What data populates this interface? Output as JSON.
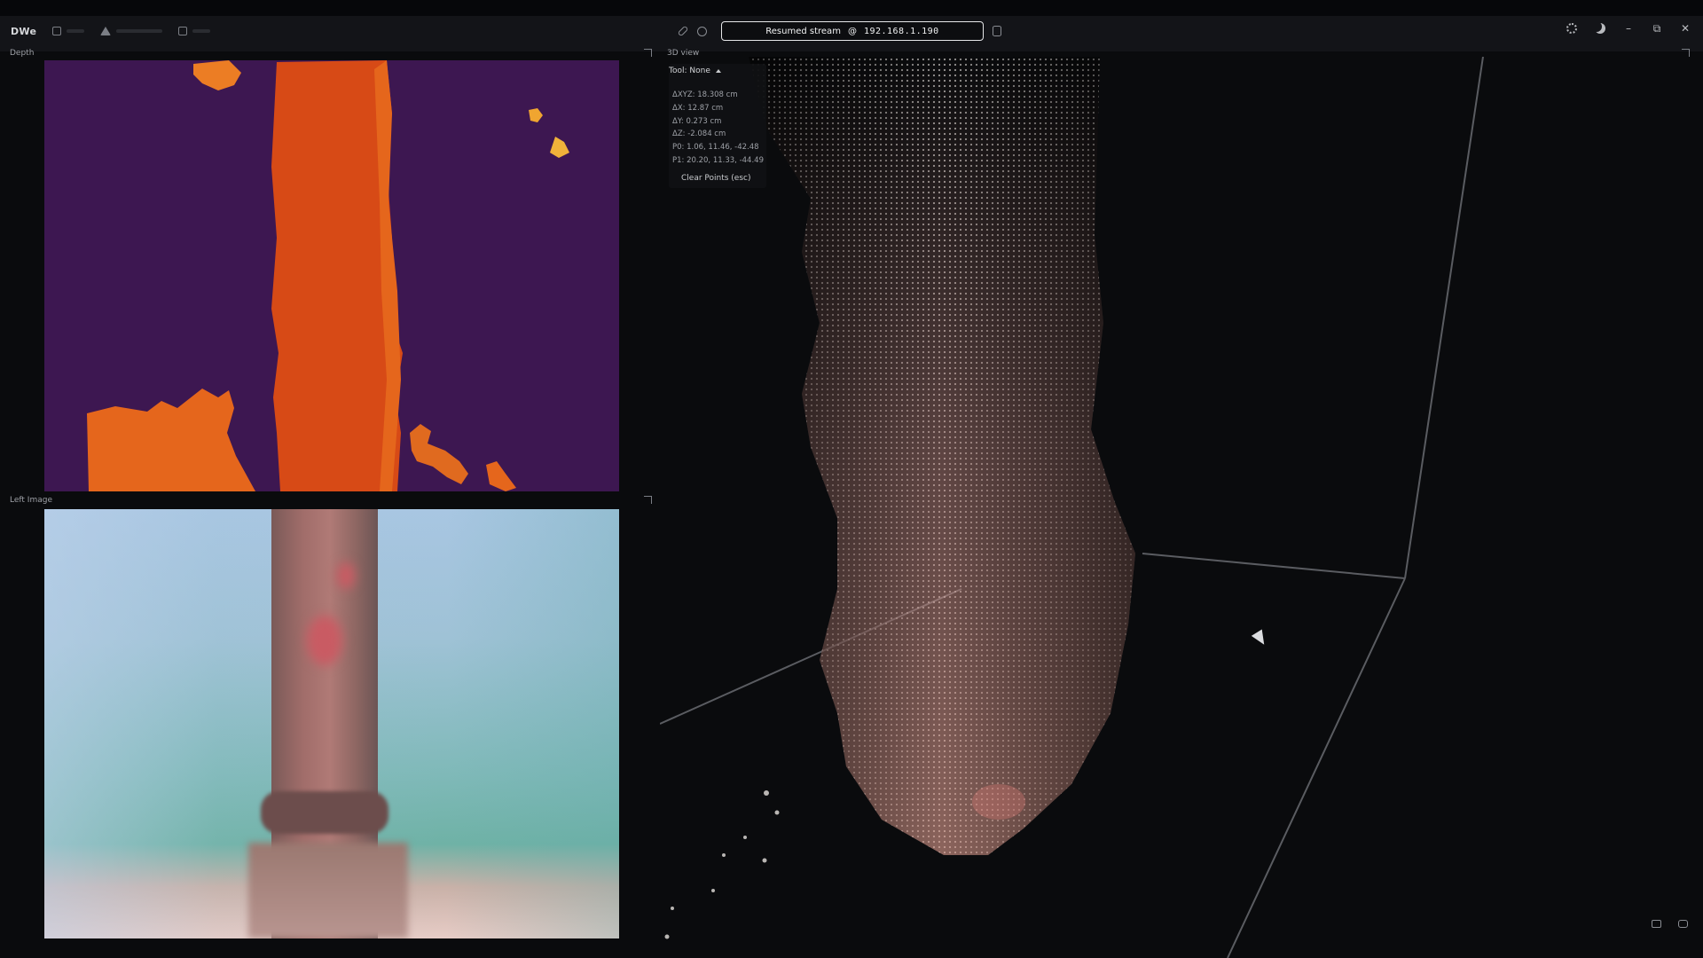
{
  "window": {
    "brand": "DWe",
    "stream_label": "Resumed stream",
    "stream_ip": "192.168.1.190"
  },
  "panels": {
    "depth": {
      "title": "Depth",
      "subtitle": ""
    },
    "left_image": {
      "title": "Left Image",
      "subtitle": ""
    },
    "points3d": {
      "title": "3D view"
    }
  },
  "tool": {
    "title": "Tool: None",
    "measurements": [
      "ΔXYZ: 18.308 cm",
      "ΔX: 12.87 cm",
      "ΔY: 0.273 cm",
      "ΔZ: -2.084 cm",
      "P0: 1.06, 11.46, -42.48",
      "P1: 20.20, 11.33, -44.49"
    ],
    "clear_button": "Clear Points (esc)"
  },
  "colors": {
    "accent": "#e6e7e9",
    "depth_background": "#3d1751",
    "depth_near": "#d74a16",
    "depth_mid": "#e5661c",
    "depth_far": "#f0a530"
  },
  "icons": {
    "topbar": [
      "layout-icon",
      "mesh-icon",
      "record-icon",
      "link-icon",
      "settings-circle-icon",
      "database-icon",
      "gear-icon",
      "moon-icon",
      "minimize-icon",
      "maximize-icon",
      "close-icon"
    ],
    "view3d": [
      "layers-icon",
      "camera-icon"
    ]
  }
}
